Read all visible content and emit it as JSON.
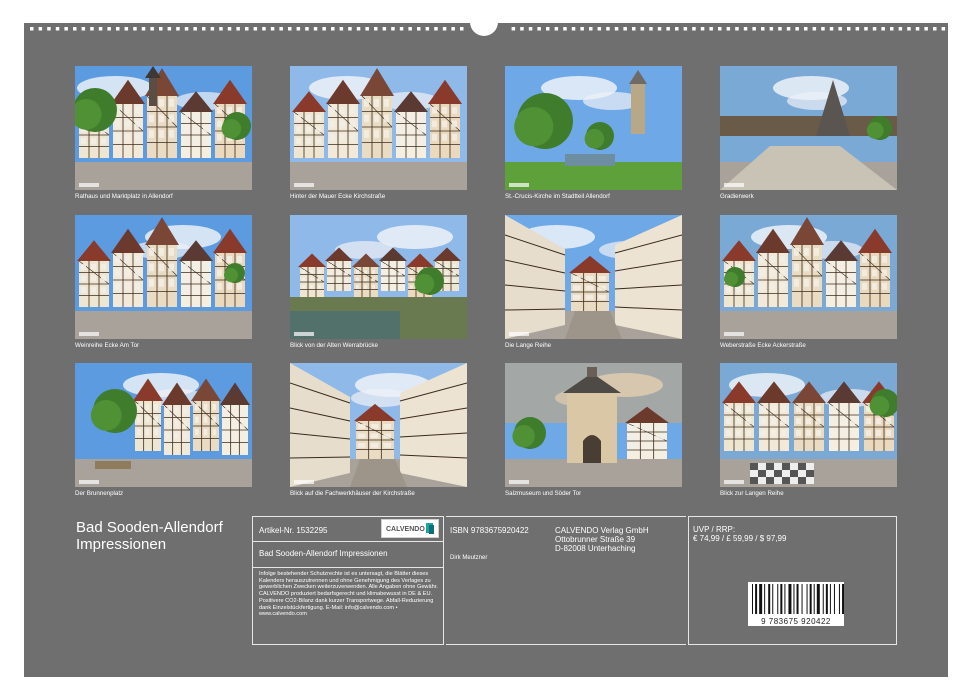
{
  "calendar": {
    "title_line1": "Bad Sooden-Allendorf",
    "title_line2": "Impressionen",
    "photos": [
      {
        "caption": "Rathaus und Marktplatz in Allendorf",
        "scene": "town-hall"
      },
      {
        "caption": "Hinter der Mauer Ecke Kirchstraße",
        "scene": "timber-street"
      },
      {
        "caption": "St.-Crucis-Kirche im Stadtteil Allendorf",
        "scene": "church-park"
      },
      {
        "caption": "Gradierwerk",
        "scene": "graduation-tower"
      },
      {
        "caption": "Weinreihe Ecke Am Tor",
        "scene": "timber-square"
      },
      {
        "caption": "Blick von der Alten Werrabrücke",
        "scene": "river-houses"
      },
      {
        "caption": "Die Lange Reihe",
        "scene": "narrow-street"
      },
      {
        "caption": "Weberstraße Ecke Ackerstraße",
        "scene": "street-corner"
      },
      {
        "caption": "Der Brunnenplatz",
        "scene": "fountain-square"
      },
      {
        "caption": "Blick auf die Fachwerkhäuser der Kirchstraße",
        "scene": "row-houses"
      },
      {
        "caption": "Salzmuseum und Söder Tor",
        "scene": "gate-tower"
      },
      {
        "caption": "Blick zur Langen Reihe",
        "scene": "chess-square"
      }
    ]
  },
  "info": {
    "article_label": "Artikel-Nr. 1532295",
    "logo_text": "CALVENDO",
    "product_title": "Bad Sooden-Allendorf Impressionen",
    "isbn": "ISBN 9783675920422",
    "author": "Dirk Meutzner",
    "publisher_line1": "CALVENDO Verlag GmbH",
    "publisher_line2": "Ottobrunner Straße 39",
    "publisher_line3": "D-82008 Unterhaching",
    "price_label": "UVP / RRP:",
    "price_values": "€ 74,99 / £ 59,99 / $ 97,99",
    "legal_text": "Infolge bestehender Schutzrechte ist es untersagt, die Blätter dieses Kalenders herauszutrennen und ohne Genehmigung des Verlages zu gewerblichen Zwecken weiterzuverwenden. Alle Angaben ohne Gewähr. CALVENDO produziert bedarfsgerecht und klimabewusst in DE & EU. Positivere CO2-Bilanz dank kurzer Transportwege. Abfall-Reduzierung dank Einzelstückfertigung. E-Mail: info@calvendo.com • www.calvendo.com",
    "barcode_number": "9 783675 920422"
  },
  "colors": {
    "sheet": "#6f6f6f",
    "text": "#ffffff",
    "logo_accent": "#1aa5a5"
  }
}
